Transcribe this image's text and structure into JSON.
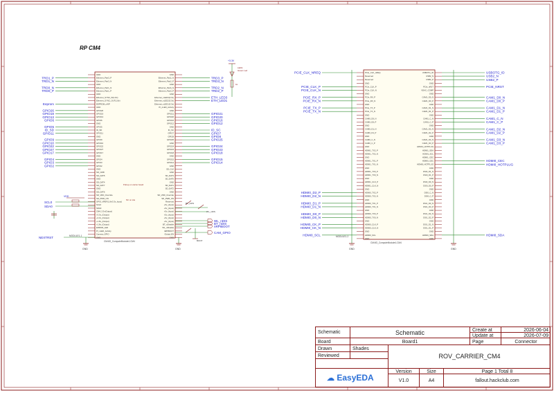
{
  "sheet_title": "RP CM4",
  "left_module": {
    "ref": "MODULE1-1",
    "part": "CM4IO_ComputeModule4-CM4",
    "left_pins": [
      "GND",
      "Ethernet_Pair3_P",
      "Ethernet_Pair3_N",
      "GND",
      "Ethernet_Pair1_N",
      "Ethernet_Pair1_P",
      "GND",
      "Ethernet_SYNC_IN(1.8v)",
      "Ethernet_SYNC_OUT(1.8v)",
      "EEPROM_nWP",
      "GND",
      "GPIO26",
      "GPIO19",
      "GPIO13",
      "GPIO6",
      "GND",
      "GPIO5",
      "ID_SD",
      "GPIO11",
      "GND",
      "GPIO9",
      "GPIO10",
      "GPIO22",
      "GPIO27",
      "GPIO17",
      "GND",
      "GPIO4",
      "GPIO3",
      "GPIO2",
      "GND",
      "SD_CMD",
      "SD_DAT5",
      "GND",
      "SD_DAT4",
      "SD_DAT7",
      "GND",
      "SD_DAT6",
      "SD_VDD_Override",
      "SD_PWR_ON",
      "GPIO_VREF(1.8v/3.3v_Input)",
      "SCL0",
      "SDA0",
      "CM4_3.3v(Output)",
      "+3.3v_(Output)",
      "+3.3v_(Output)",
      "+1.8v_(Output)",
      "+1.8v_(Output)",
      "ERROR_LED",
      "PI_nLED_Activity",
      "Camera_GPIO",
      "GND"
    ],
    "right_pins": [
      "GND",
      "Ethernet_Pair2_N",
      "Ethernet_Pair2_P",
      "GND",
      "Ethernet_Pair0_N",
      "Ethernet_Pair0_P",
      "GND",
      "Ethernet_nLED3(3.3v)",
      "Ethernet_nLED2(3.3v)",
      "Ethernet_nLED1(3.3v)",
      "PI_nLED_Activity",
      "GND",
      "GPIO21",
      "GPIO20",
      "GPIO16",
      "GPIO12",
      "GND",
      "ID_SC",
      "GPIO7",
      "GPIO8",
      "GPIO25",
      "GND",
      "GPIO24",
      "GPIO23",
      "GPIO18",
      "GND",
      "GPIO15",
      "GPIO14",
      "GND",
      "SD_CLK",
      "GND",
      "SD_DAT3",
      "SD_DAT0",
      "GND",
      "SD_DAT1",
      "SD_DAT2",
      "GND",
      "SD_VDD_Override",
      "SD_PWR_ON",
      "Reserved",
      "+5v_(Input)",
      "+5v_(Input)",
      "+5v_(Input)",
      "+5v_(Input)",
      "+5v_(Input)",
      "+5v_(Input)",
      "BT_nDisable",
      "WL_nDisable",
      "nRPIBOOT",
      "Global_EN",
      "GND"
    ]
  },
  "left_nets_left": [
    {
      "label": "TRD1_P",
      "pin": 1
    },
    {
      "label": "TRD1_N",
      "pin": 2
    },
    {
      "label": "TRD0_N",
      "pin": 4
    },
    {
      "label": "TRD0_P",
      "pin": 5
    },
    {
      "label": "Eeprom",
      "pin": 9
    },
    {
      "label": "GPIO26",
      "pin": 11
    },
    {
      "label": "GPIO19",
      "pin": 12
    },
    {
      "label": "GPIO13",
      "pin": 13
    },
    {
      "label": "GPIO6",
      "pin": 14
    },
    {
      "label": "GPIO5",
      "pin": 16
    },
    {
      "label": "ID_SD",
      "pin": 17
    },
    {
      "label": "GPIO11",
      "pin": 18
    },
    {
      "label": "GPIO9",
      "pin": 20
    },
    {
      "label": "GPIO10",
      "pin": 21
    },
    {
      "label": "GPIO22",
      "pin": 22
    },
    {
      "label": "GPIO27",
      "pin": 23
    },
    {
      "label": "GPIO17",
      "pin": 24
    },
    {
      "label": "GPIO4",
      "pin": 26
    },
    {
      "label": "GPIO3",
      "pin": 27
    },
    {
      "label": "GPIO2",
      "pin": 28
    }
  ],
  "left_nets_right": [
    {
      "label": "TRD3_P",
      "pin": 1
    },
    {
      "label": "TRD3_N",
      "pin": 2
    },
    {
      "label": "TRD2_N",
      "pin": 4
    },
    {
      "label": "TRD2_P",
      "pin": 5
    },
    {
      "label": "ETH_LED3",
      "pin": 7
    },
    {
      "label": "ETH_LED1",
      "pin": 8
    },
    {
      "label": "GPIO21",
      "pin": 12
    },
    {
      "label": "GPIO20",
      "pin": 13
    },
    {
      "label": "GPIO16",
      "pin": 14
    },
    {
      "label": "GPIO12",
      "pin": 15
    },
    {
      "label": "ID_SC",
      "pin": 17
    },
    {
      "label": "GPIO7",
      "pin": 18
    },
    {
      "label": "GPIO8",
      "pin": 19
    },
    {
      "label": "GPIO25",
      "pin": 20
    },
    {
      "label": "GPIO24",
      "pin": 22
    },
    {
      "label": "GPIO23",
      "pin": 23
    },
    {
      "label": "GPIO18",
      "pin": 24
    },
    {
      "label": "GPIO15",
      "pin": 26
    },
    {
      "label": "GPIO14",
      "pin": 27
    }
  ],
  "left_misc": {
    "scl_label": "SCL0",
    "sda_label": "SDA0",
    "nextrst_label": "NEXTRST",
    "vdd_label": "VDD",
    "gnd_label": "GND",
    "v33_label": "+3.3V",
    "led_ref": "LED1",
    "led_val": "Green Led",
    "r_label": "1k",
    "bt_label": "BT_nDIS",
    "wl_label": "WL_nDIS",
    "boot_label": "BOOT",
    "wl_net": "WL_nDIS",
    "bt_net": "BT_nDIS",
    "boot_net": "nRPIBOOT",
    "cam_net": "CAM_GPIO",
    "note1": "Pull-up on carrier board",
    "note2": "NC on Lite"
  },
  "right_module": {
    "ref": "MODULE1-2",
    "part": "CM4IO_ComputeModule4-CM4",
    "left_pins": [
      "PCIe_CLK_nREQ",
      "Reserved",
      "Reserved",
      "GND",
      "PCIe_CLK_P",
      "PCIe_CLK_N",
      "GND",
      "PCIe_RX_P",
      "PCIe_RX_N",
      "GND",
      "PCIe_TX_P",
      "PCIe_TX_N",
      "GND",
      "CAM0_D0_N",
      "CAM0_D0_P",
      "GND",
      "CAM0_D1_N",
      "CAM0_D1_P",
      "GND",
      "CAM0_C_N",
      "CAM0_C_P",
      "GND",
      "HDMI1_TX2_P",
      "HDMI1_TX2_N",
      "GND",
      "HDMI1_TX1_P",
      "HDMI1_TX1_N",
      "GND",
      "HDMI1_TX0_P",
      "HDMI1_TX0_N",
      "GND",
      "HDMI1_CLK_P",
      "HDMI1_CLK_N",
      "GND",
      "HDMI0_TX2_P",
      "HDMI0_TX2_N",
      "GND",
      "HDMI0_TX1_P",
      "HDMI0_TX1_N",
      "GND",
      "HDMI0_TX0_P",
      "HDMI0_TX0_N",
      "GND",
      "HDMI0_CLK_P",
      "HDMI0_CLK_N",
      "GND",
      "HDMI0_SCL",
      "GND"
    ],
    "right_pins": [
      "USBOTG_ID",
      "USB2_N",
      "USB2_P",
      "GND",
      "PCIe_nRST",
      "VDAC_COMP",
      "GND",
      "CAM1_D0_N",
      "CAM1_D0_P",
      "GND",
      "CAM1_D1_N",
      "CAM1_D1_P",
      "GND",
      "CAM1_C_N",
      "CAM1_C_P",
      "GND",
      "CAM1_D2_N",
      "CAM1_D2_P",
      "GND",
      "CAM1_D3_N",
      "CAM1_D3_P",
      "HDMI1_HOTPLUG",
      "HDMI1_SDA",
      "HDMI1_SCL",
      "HDMI1_CEC",
      "HDMI0_CEC",
      "HDMI0_HOTPLUG",
      "GND",
      "DSI0_D1_N",
      "DSI0_D1_P",
      "GND",
      "DSI0_D0_N",
      "DSI0_D0_P",
      "GND",
      "DSI0_C_N",
      "DSI0_C_P",
      "GND",
      "DSI1_D3_N",
      "DSI1_D3_P",
      "GND",
      "DSI1_D2_N",
      "DSI1_D2_P",
      "GND",
      "DSI1_D1_N",
      "DSI1_D1_P",
      "GND",
      "HDMI0_SDA",
      "GND"
    ]
  },
  "right_nets_left": [
    {
      "label": "PCIE_CLK_NREQ",
      "pin": 0
    },
    {
      "label": "PCIE_CLK_P",
      "pin": 4
    },
    {
      "label": "PCIE_CLK_N",
      "pin": 5
    },
    {
      "label": "PCIE_RX_P",
      "pin": 7
    },
    {
      "label": "PCIE_RX_N",
      "pin": 8
    },
    {
      "label": "PCIE_TX_P",
      "pin": 10
    },
    {
      "label": "PCIE_TX_N",
      "pin": 11
    },
    {
      "label": "HDMI0_D2_P",
      "pin": 34
    },
    {
      "label": "HDMI0_D2_N",
      "pin": 35
    },
    {
      "label": "HDMI0_D1_P",
      "pin": 37
    },
    {
      "label": "HDMI0_D1_N",
      "pin": 38
    },
    {
      "label": "HDMI0_D0_P",
      "pin": 40
    },
    {
      "label": "HDMI0_D0_N",
      "pin": 41
    },
    {
      "label": "HDMI0_CK_P",
      "pin": 43
    },
    {
      "label": "HDMI0_CK_N",
      "pin": 44
    },
    {
      "label": "HDMI0_SCL",
      "pin": 46
    }
  ],
  "right_nets_right": [
    {
      "label": "USBOTG_ID",
      "pin": 0
    },
    {
      "label": "USB2_N",
      "pin": 1
    },
    {
      "label": "USB2_P",
      "pin": 2
    },
    {
      "label": "PCIE_NRST",
      "pin": 4
    },
    {
      "label": "CAM1_D0_N",
      "pin": 7
    },
    {
      "label": "CAM1_D0_P",
      "pin": 8
    },
    {
      "label": "CAM1_D1_N",
      "pin": 10
    },
    {
      "label": "CAM1_D1_P",
      "pin": 11
    },
    {
      "label": "CAM1_C_N",
      "pin": 13
    },
    {
      "label": "CAM1_C_P",
      "pin": 14
    },
    {
      "label": "CAM1_D2_N",
      "pin": 16
    },
    {
      "label": "CAM1_D2_P",
      "pin": 17
    },
    {
      "label": "CAM1_D3_N",
      "pin": 19
    },
    {
      "label": "CAM1_D3_P",
      "pin": 20
    },
    {
      "label": "HDMI0_CEC",
      "pin": 25
    },
    {
      "label": "HDMI0_HOTPLUG",
      "pin": 26
    },
    {
      "label": "HDMI0_SDA",
      "pin": 46
    }
  ],
  "title_block": {
    "type_label": "Schematic",
    "type_value": "Schematic",
    "create_label": "Create at",
    "create_value": "2026-06-04",
    "update_label": "Update at",
    "update_value": "2026-07-09",
    "board_label": "Board",
    "board_value": "Board1",
    "page_label": "Page",
    "page_value": "Connector",
    "drawn_label": "Drawn",
    "drawn_value": "Shades",
    "reviewed_label": "Reviewed",
    "project": "ROV_CARRIER_CM4",
    "version_label": "Version",
    "version_value": "V1.0",
    "size_label": "Size",
    "size_value": "A4",
    "pages_text": "Page  1  Total  8",
    "site": "fallout.hackclub.com",
    "logo": "EasyEDA"
  },
  "colors": {
    "border": "#8a1a1a",
    "wire": "#2e8b2e",
    "label": "#1a1acc",
    "pin": "#8a1a1a",
    "text": "#333333"
  }
}
